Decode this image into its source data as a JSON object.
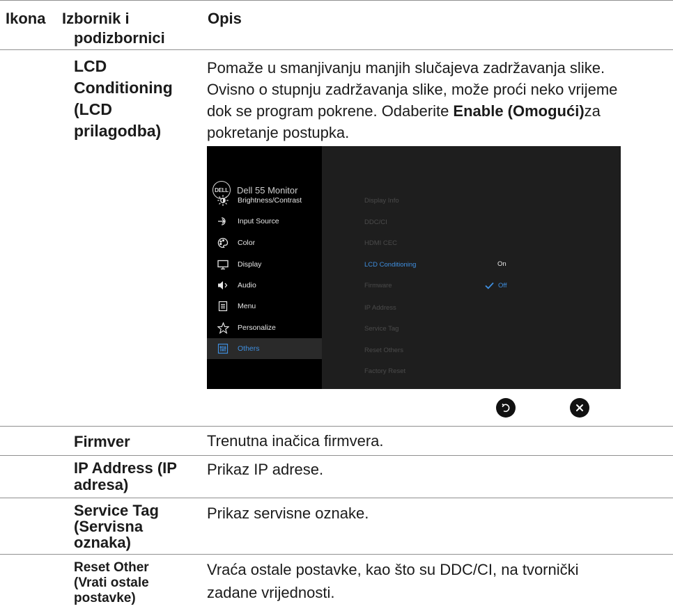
{
  "header": {
    "col_icon": "Ikona",
    "col_menu_line1": "Izbornik i",
    "col_menu_line2": "podizbornici",
    "col_desc": "Opis"
  },
  "lcd": {
    "title_lines": [
      "LCD",
      "Conditioning",
      "(LCD",
      "prilagodba)"
    ],
    "desc_line1": "Pomaže u smanjivanju manjih slučajeva zadržavanja slike.",
    "desc_line2": "Ovisno o stupnju zadržavanja slike, može proći neko vrijeme",
    "desc_line3_pre": "dok se program pokrene. Odaberite ",
    "desc_line3_bold": "Enable (Omogući)",
    "desc_line3_post": "za",
    "desc_line4": "pokretanje postupka."
  },
  "osd": {
    "logo": "DELL",
    "model": "Dell 55 Monitor",
    "menu": [
      {
        "label": "Brightness/Contrast",
        "icon": "brightness-icon"
      },
      {
        "label": "Input Source",
        "icon": "input-source-icon"
      },
      {
        "label": "Color",
        "icon": "color-icon"
      },
      {
        "label": "Display",
        "icon": "display-icon"
      },
      {
        "label": "Audio",
        "icon": "audio-icon"
      },
      {
        "label": "Menu",
        "icon": "menu-icon"
      },
      {
        "label": "Personalize",
        "icon": "star-icon"
      },
      {
        "label": "Others",
        "icon": "others-icon",
        "selected": true
      }
    ],
    "submenu": [
      {
        "label": "Display Info"
      },
      {
        "label": "DDC/CI"
      },
      {
        "label": "HDMI CEC"
      },
      {
        "label": "LCD Conditioning",
        "active": true
      },
      {
        "label": "Firmware"
      },
      {
        "label": "IP Address"
      },
      {
        "label": "Service Tag"
      },
      {
        "label": "Reset Others"
      },
      {
        "label": "Factory Reset"
      }
    ],
    "options": [
      {
        "label": "On"
      },
      {
        "label": "Off",
        "selected": true
      }
    ],
    "accent_color": "#3f8fe0"
  },
  "rows": [
    {
      "title_lines": [
        "Firmver"
      ],
      "desc": "Trenutna inačica firmvera."
    },
    {
      "title_lines": [
        "IP Address (IP",
        "adresa)"
      ],
      "desc": "Prikaz IP adrese."
    },
    {
      "title_lines": [
        "Service Tag",
        "(Servisna",
        "oznaka)"
      ],
      "desc": "Prikaz servisne oznake."
    },
    {
      "title_lines": [
        "Reset Other",
        "(Vrati ostale",
        "postavke)"
      ],
      "desc_lines": [
        "Vraća ostale postavke, kao što su DDC/CI, na tvornički",
        "zadane vrijednosti."
      ]
    }
  ]
}
